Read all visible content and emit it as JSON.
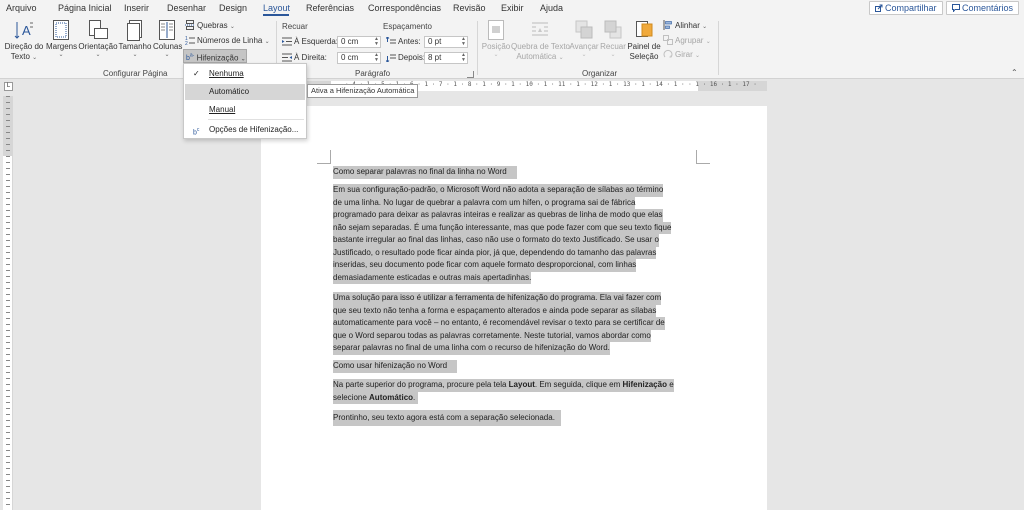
{
  "menubar": {
    "tabs": [
      "Arquivo",
      "Página Inicial",
      "Inserir",
      "Desenhar",
      "Design",
      "Layout",
      "Referências",
      "Correspondências",
      "Revisão",
      "Exibir",
      "Ajuda"
    ],
    "active_tab": "Layout",
    "share_label": "Compartilhar",
    "comments_label": "Comentários",
    "accent_color": "#2b579a"
  },
  "ribbon": {
    "page_setup": {
      "direction_label_1": "Direção do",
      "direction_label_2": "Texto",
      "margins_label": "Margens",
      "orientation_label": "Orientação",
      "size_label": "Tamanho",
      "columns_label": "Colunas",
      "breaks_label": "Quebras",
      "line_numbers_label": "Números de Linha",
      "hyphenation_label": "Hifenização",
      "group_label": "Configurar Página"
    },
    "paragraph": {
      "indent_header": "Recuar",
      "spacing_header": "Espaçamento",
      "left_label": "À Esquerda:",
      "left_value": "0 cm",
      "right_label": "À Direita:",
      "right_value": "0 cm",
      "before_label": "Antes:",
      "before_value": "0 pt",
      "after_label": "Depois:",
      "after_value": "8 pt",
      "group_label": "Parágrafo"
    },
    "arrange": {
      "position_label": "Posição",
      "wrap_label_1": "Quebra de Texto",
      "wrap_label_2": "Automática",
      "forward_label": "Avançar",
      "backward_label": "Recuar",
      "selection_pane_label_1": "Painel de",
      "selection_pane_label_2": "Seleção",
      "align_label": "Alinhar",
      "group_label_small": "Agrupar",
      "rotate_label": "Girar",
      "group_label": "Organizar"
    }
  },
  "hyphenation_menu": {
    "items": [
      {
        "label": "Nenhuma",
        "checked": true
      },
      {
        "label": "Automático",
        "hover": true
      },
      {
        "label": "Manual"
      },
      {
        "label": "Opções de Hifenização..."
      }
    ],
    "tooltip": "Ativa a Hifenização Automática"
  },
  "document": {
    "title1": "Como separar palavras no final da linha no Word",
    "para1": [
      "Em sua configuração-padrão, o Microsoft Word não adota a separação de sílabas ao término",
      "de uma linha. No lugar de quebrar a palavra com um hífen, o programa sai de fábrica",
      "programado para deixar as palavras inteiras e realizar as quebras de linha de modo que elas",
      "não sejam separadas. É uma função interessante, mas que pode fazer com que seu texto fique",
      "bastante irregular ao final das linhas, caso não use o formato do texto Justificado. Se usar o",
      "Justificado, o resultado pode ficar ainda pior, já que, dependendo do tamanho das palavras",
      "inseridas, seu documento pode ficar com aquele formato desproporcional, com linhas",
      "demasiadamente esticadas e outras mais apertadinhas."
    ],
    "para2": [
      "Uma solução para isso é utilizar a ferramenta de hifenização do programa. Ela vai fazer com",
      "que seu texto não tenha a forma e espaçamento alterados e ainda pode separar as sílabas",
      "automaticamente para você – no entanto, é recomendável revisar o texto para se certificar de",
      "que o Word separou todas as palavras corretamente. Neste tutorial, vamos abordar como",
      "separar palavras no final de uma linha com o recurso de hifenização do Word."
    ],
    "title2": "Como usar hifenização no Word",
    "para3_a": "Na parte superior do programa, procure pela tela ",
    "para3_b": "Layout",
    "para3_c": ". Em seguida, clique em ",
    "para3_d": "Hifenização",
    "para3_e": " e",
    "para3_f": "selecione ",
    "para3_g": "Automático",
    "para3_h": ".",
    "para4": "Prontinho, seu texto agora está com a separação selecionada.",
    "highlight_color": "#c6c6c6"
  },
  "ruler": {
    "marks": "· 4 · 1 · 5 · 1 · 6 · 1 · 7 · 1 · 8 · 1 · 9 · 1 · 10 · 1 · 11 · 1 · 12 · 1 · 13 · 1 · 14 · 1 ·  · 1 · 16 · 1 · 17 ·",
    "corner": "L"
  }
}
